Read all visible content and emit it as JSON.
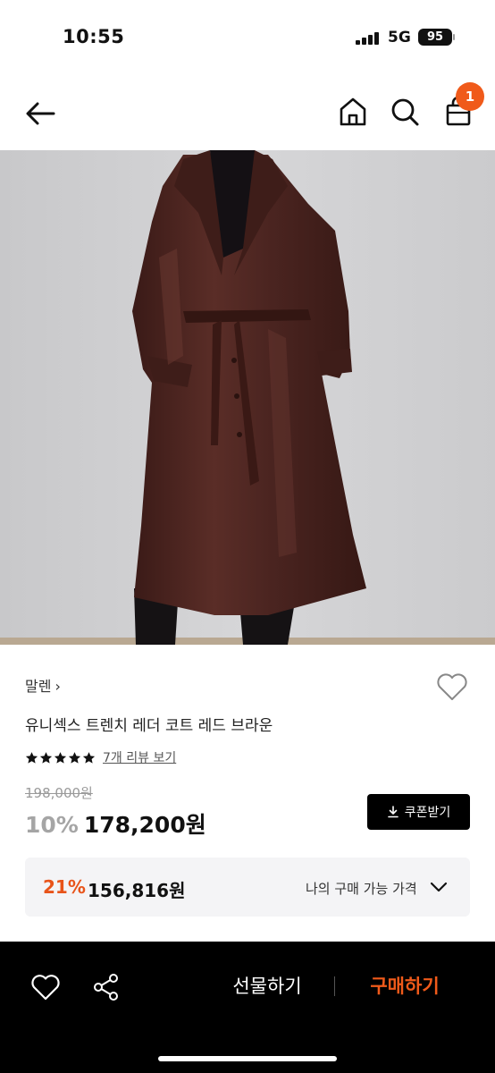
{
  "status": {
    "time": "10:55",
    "network": "5G",
    "battery": "95"
  },
  "nav": {
    "cart_count": "1"
  },
  "product": {
    "brand": "말렌",
    "name": "유니섹스 트렌치 레더 코트 레드 브라운",
    "rating_stars": 5,
    "review_link": "7개 리뷰 보기",
    "original_price": "198,000원",
    "discount_rate": "10%",
    "sale_price": "178,200원",
    "coupon_label": "쿠폰받기",
    "my_price": {
      "rate": "21%",
      "value": "156,816원",
      "label": "나의 구매 가능 가격"
    }
  },
  "bottom_bar": {
    "gift_label": "선물하기",
    "buy_label": "구매하기"
  },
  "colors": {
    "accent": "#F05A1A",
    "coat": "#4A2420",
    "background": "#CFCFD0"
  },
  "icons": [
    "back-arrow-icon",
    "home-icon",
    "search-icon",
    "shopping-bag-icon",
    "heart-icon",
    "star-icon",
    "download-icon",
    "chevron-down-icon",
    "share-icon"
  ]
}
